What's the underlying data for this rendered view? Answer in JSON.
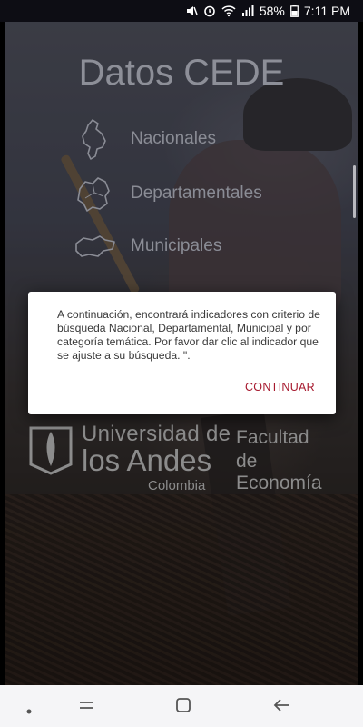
{
  "status_bar": {
    "battery": "58%",
    "time": "7:11 PM"
  },
  "app": {
    "title": "Datos CEDE"
  },
  "menu": {
    "items": [
      {
        "label": "Nacionales",
        "icon": "colombia-map-icon"
      },
      {
        "label": "Departamentales",
        "icon": "department-map-icon"
      },
      {
        "label": "Municipales",
        "icon": "municipality-map-icon"
      }
    ]
  },
  "logo": {
    "university_line1": "Universidad de",
    "university_line2": "los Andes",
    "university_line3": "Colombia",
    "faculty_line1": "Facultad",
    "faculty_line2": "de Economía"
  },
  "dialog": {
    "message": "A continuación, encontrará indicadores con criterio de búsqueda Nacional, Departamental, Municipal y por categoría temática. Por favor dar clic al indicador que se ajuste a su búsqueda. \".",
    "button_label": "CONTINUAR"
  },
  "colors": {
    "accent": "#a6192e",
    "dialog_bg": "#ffffff",
    "nav_bg": "#f5f5f7"
  },
  "nav_bar": {
    "icons": [
      "dot-icon",
      "recent-apps-icon",
      "home-icon",
      "back-icon"
    ]
  }
}
